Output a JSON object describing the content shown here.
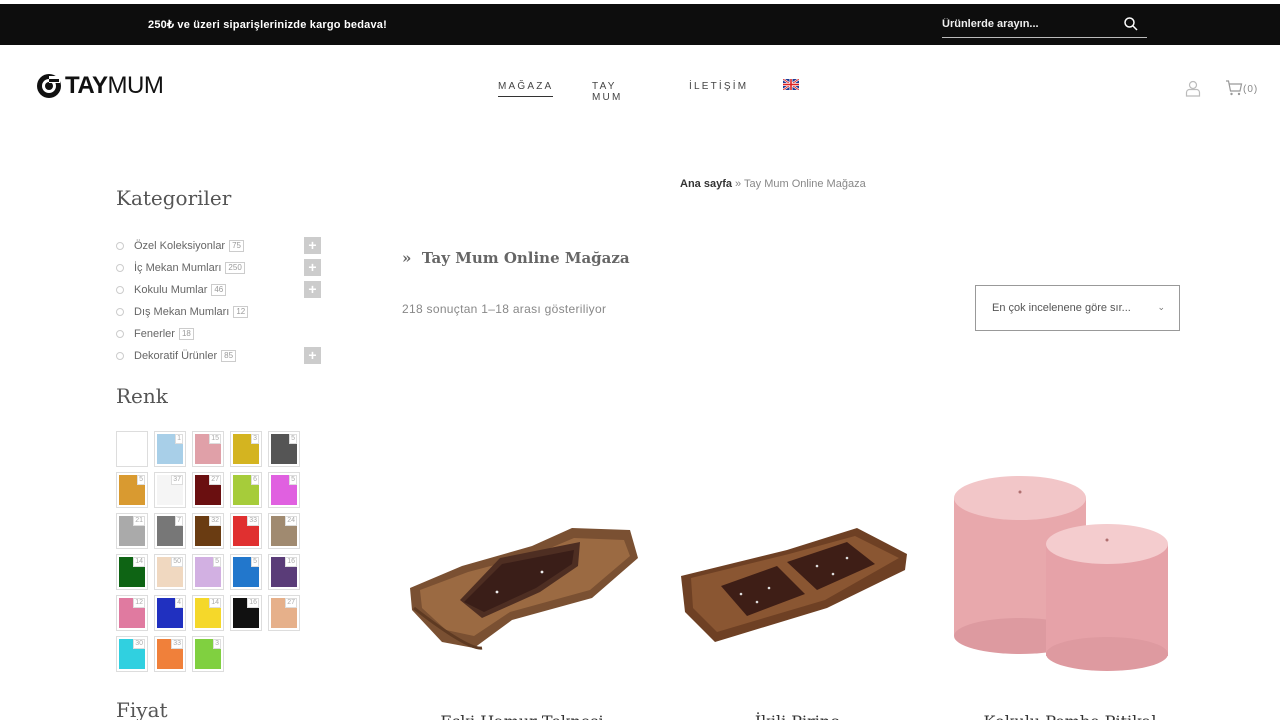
{
  "topbar": {
    "promo": "250₺ ve üzeri siparişlerinizde kargo bedava!",
    "search_placeholder": "Ürünlerde arayın..."
  },
  "logo": {
    "tay": "TAY",
    "mum": "MUM"
  },
  "nav": {
    "items": [
      "MAĞAZA",
      "TAY MUM",
      "İLETİŞİM"
    ],
    "active": "MAĞAZA",
    "language_icon": "uk-flag-icon"
  },
  "header_icons": {
    "account": "user-icon",
    "cart": "cart-icon",
    "cart_count": "(0)"
  },
  "sidebar": {
    "categories_title": "Kategoriler",
    "categories": [
      {
        "label": "Özel Koleksiyonlar",
        "count": "75",
        "expandable": true
      },
      {
        "label": "İç Mekan Mumları",
        "count": "250",
        "expandable": true
      },
      {
        "label": "Kokulu Mumlar",
        "count": "46",
        "expandable": true
      },
      {
        "label": "Dış Mekan Mumları",
        "count": "12",
        "expandable": false
      },
      {
        "label": "Fenerler",
        "count": "18",
        "expandable": false
      },
      {
        "label": "Dekoratif Ürünler",
        "count": "85",
        "expandable": true
      }
    ],
    "color_title": "Renk",
    "colors": [
      {
        "color": "#ffffff",
        "count": ""
      },
      {
        "color": "#a8cfe8",
        "count": "1"
      },
      {
        "color": "#e0a0a8",
        "count": "15"
      },
      {
        "color": "#d4b420",
        "count": "3"
      },
      {
        "color": "#555555",
        "count": "5"
      },
      {
        "color": "#d99a30",
        "count": "5"
      },
      {
        "color": "#f5f5f5",
        "count": "37"
      },
      {
        "color": "#6a0f10",
        "count": "27"
      },
      {
        "color": "#a6cc3a",
        "count": "6"
      },
      {
        "color": "#e060e0",
        "count": "5"
      },
      {
        "color": "#aaaaaa",
        "count": "21"
      },
      {
        "color": "#777777",
        "count": "7"
      },
      {
        "color": "#6a3c12",
        "count": "32"
      },
      {
        "color": "#e03030",
        "count": "33"
      },
      {
        "color": "#a08a70",
        "count": "24"
      },
      {
        "color": "#0e6414",
        "count": "14"
      },
      {
        "color": "#f0d8c0",
        "count": "50"
      },
      {
        "color": "#d2b0e2",
        "count": "5"
      },
      {
        "color": "#2277cc",
        "count": "5"
      },
      {
        "color": "#5a3c78",
        "count": "16"
      },
      {
        "color": "#e07aa0",
        "count": "12"
      },
      {
        "color": "#2030c0",
        "count": "4"
      },
      {
        "color": "#f5d82a",
        "count": "14"
      },
      {
        "color": "#111111",
        "count": "16"
      },
      {
        "color": "#e6b08a",
        "count": "27"
      },
      {
        "color": "#30d0e0",
        "count": "30"
      },
      {
        "color": "#f0803a",
        "count": "33"
      },
      {
        "color": "#80d040",
        "count": "3"
      }
    ],
    "price_title": "Fiyat"
  },
  "main": {
    "breadcrumb_home": "Ana sayfa",
    "breadcrumb_sep": "»",
    "breadcrumb_current": "Tay Mum Online Mağaza",
    "title_prefix": "»",
    "title": "Tay Mum Online Mağaza",
    "result_count": "218 sonuçtan 1–18 arası gösteriliyor",
    "sort_label": "En çok incelenene göre sır..."
  },
  "products": [
    {
      "name": "Eski Hamur Teknesi",
      "image": "wooden-trough-candle"
    },
    {
      "name": "İkili Pirinç",
      "image": "double-wooden-tray-candle"
    },
    {
      "name": "Kokulu Pembe Pitikal",
      "image": "pink-pillar-candles"
    }
  ]
}
